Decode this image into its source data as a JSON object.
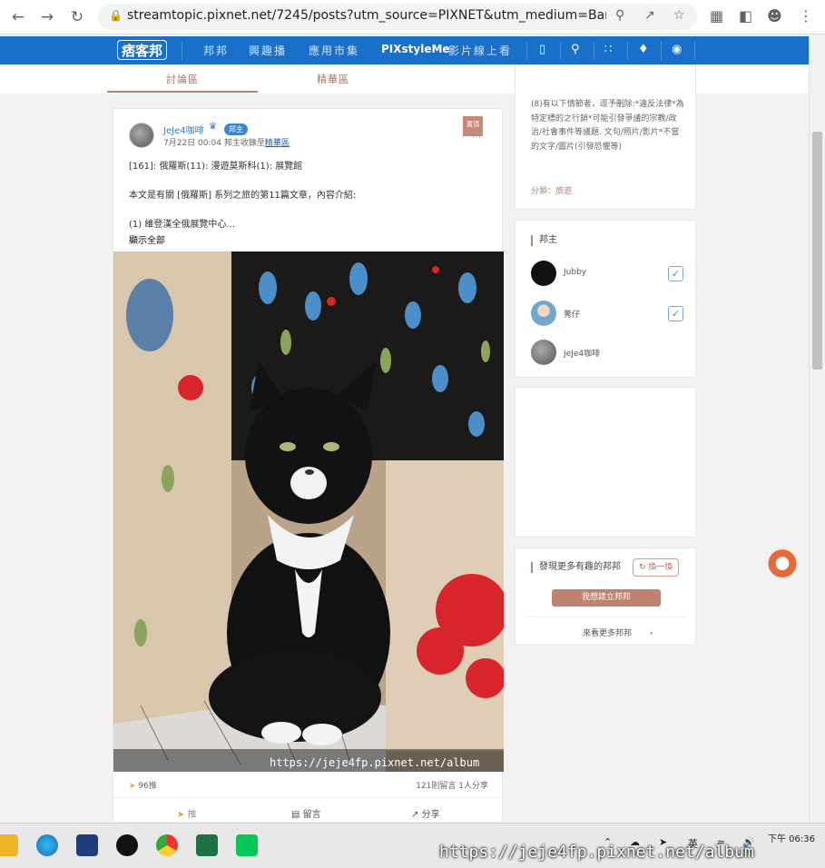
{
  "browser": {
    "url": "streamtopic.pixnet.net/7245/posts?utm_source=PIXNET&utm_medium=Band..."
  },
  "site_nav": {
    "logo": "痞客邦",
    "links": [
      "邦邦",
      "興趣播",
      "應用市集",
      "PIXstyleMe",
      "影片線上看"
    ]
  },
  "tabs": [
    "討論區",
    "精華區"
  ],
  "post": {
    "author": "JeJe4咖啡",
    "badge": "邦主",
    "date": "7月22日 00:04",
    "collected_prefix": "邦主收錄至",
    "collected_link": "精華區",
    "pin_label": "置頂",
    "title": "[161]: 俄羅斯(11): 漫遊莫斯科(1): 展覽館",
    "intro": "本文是有關 [俄羅斯] 系列之旅的第11篇文章，內容介紹:",
    "list_item": "(1) 維登漢全俄展覽中心...",
    "show_all": "顯示全部",
    "watermark": "https://jeje4fp.pixnet.net/album",
    "likes": "96推",
    "comments_shares": "121則留言  1人分享",
    "actions": {
      "like": "推",
      "comment": "留言",
      "share": "分享"
    }
  },
  "sidebar": {
    "rules": "(8)有以下情節者，逕予刪除:*違反法律*為特定標的之行銷*可能引發爭議的宗教/政治/社會事件等議題. 文句/照片/影片*不當的文字/圖片(引發恐懼等)",
    "category": "分類：旅遊",
    "moderators_title": "邦主",
    "moderators": [
      {
        "name": "Jubby",
        "checked": true
      },
      {
        "name": "莠仔",
        "checked": true
      },
      {
        "name": "JeJe4咖啡",
        "checked": false
      }
    ],
    "discover_title": "發現更多有趣的邦邦",
    "swap_label": "換一換",
    "create_label": "我想建立邦邦",
    "more_label": "來看更多邦邦"
  },
  "taskbar": {
    "time": "下午 06:36",
    "lang": "英",
    "watermark": "https://jeje4fp.pixnet.net/album"
  },
  "colors": {
    "nav_blue": "#1a6fc9",
    "accent_brown": "#b08574",
    "link_blue": "#3a7ac2"
  }
}
